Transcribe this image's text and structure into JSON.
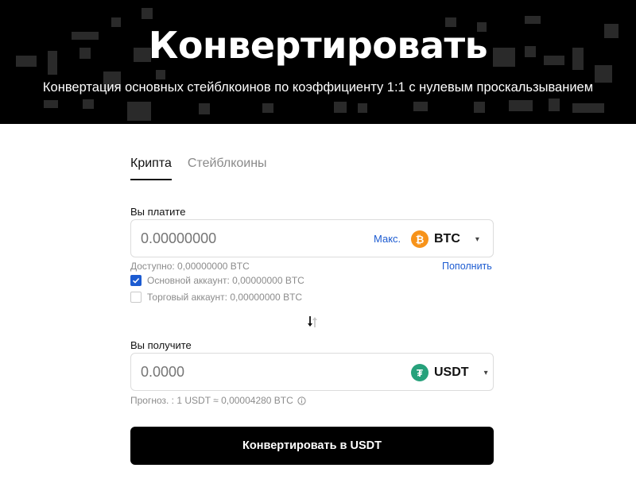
{
  "hero": {
    "title": "Конвертировать",
    "subtitle": "Конвертация основных стейблкоинов по коэффициенту 1:1 с нулевым проскальзыванием"
  },
  "tabs": [
    {
      "label": "Крипта",
      "active": true
    },
    {
      "label": "Стейблкоины",
      "active": false
    }
  ],
  "pay": {
    "label": "Вы платите",
    "amount_placeholder": "0.00000000",
    "max_label": "Макс.",
    "coin": {
      "symbol": "BTC",
      "icon": "bitcoin-icon",
      "color": "#f7931a"
    },
    "available": "Доступно: 0,00000000 BTC",
    "deposit_link": "Пополнить",
    "accounts": [
      {
        "label": "Основной аккаунт: 0,00000000 BTC",
        "checked": true
      },
      {
        "label": "Торговый аккаунт: 0,00000000 BTC",
        "checked": false
      }
    ]
  },
  "receive": {
    "label": "Вы получите",
    "amount_placeholder": "0.0000",
    "coin": {
      "symbol": "USDT",
      "icon": "tether-icon",
      "color": "#26a17b"
    },
    "estimate": "Прогноз. : 1 USDT ≈ 0,00004280 BTC"
  },
  "action": {
    "convert_label": "Конвертировать в USDT"
  },
  "colors": {
    "accent": "#1c5bd1",
    "hero_bg": "#000000",
    "button_bg": "#000000"
  }
}
